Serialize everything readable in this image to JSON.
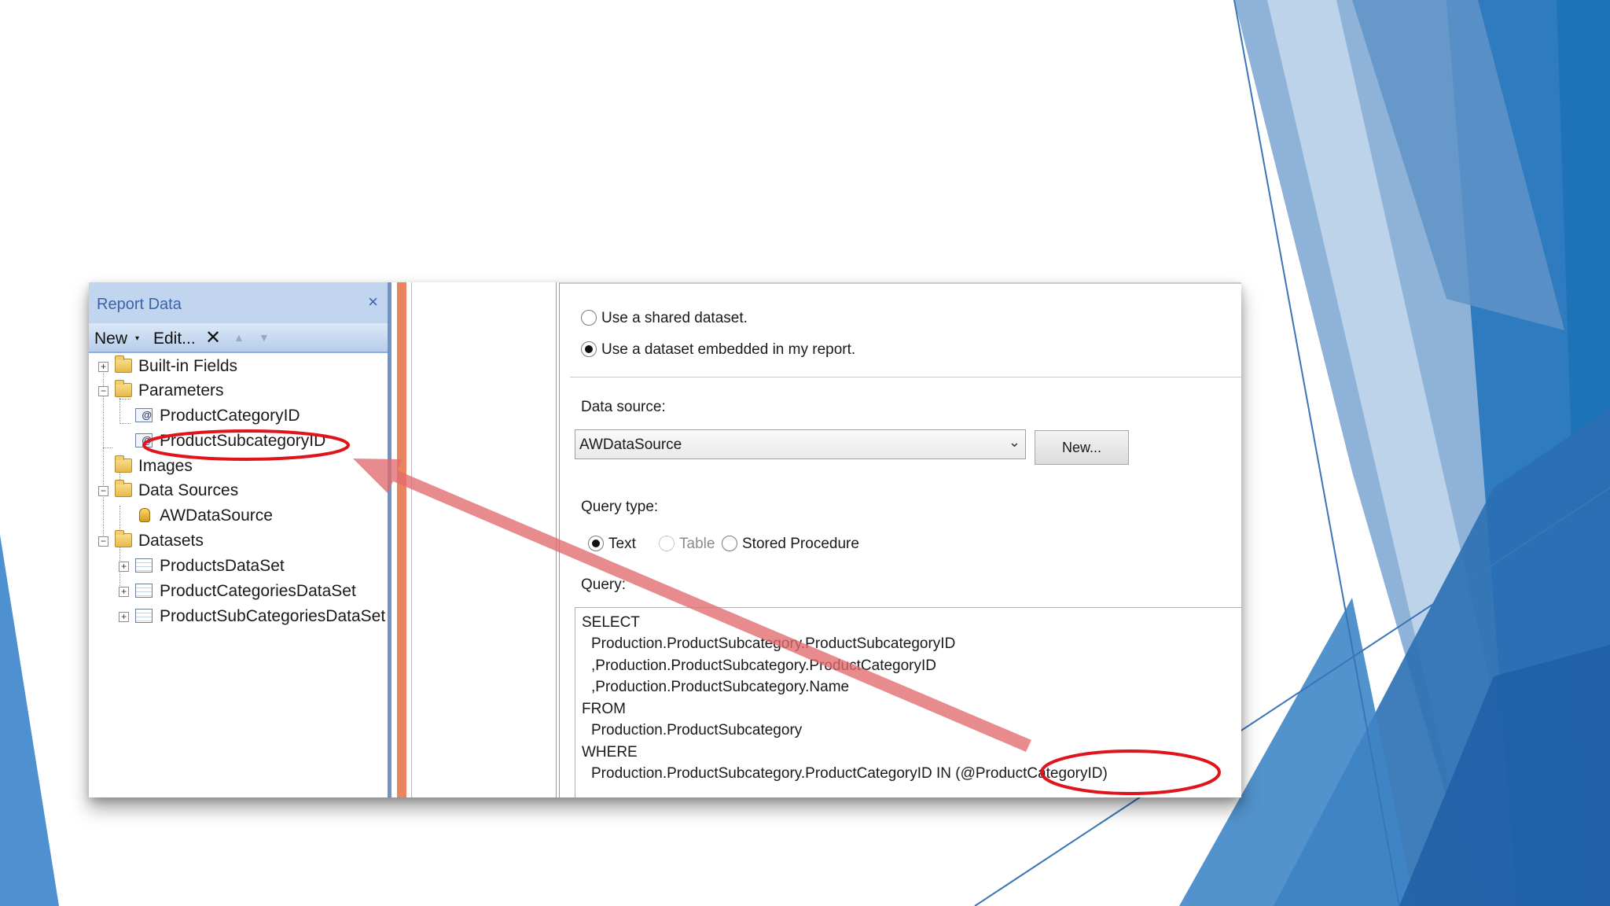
{
  "report_data": {
    "title": "Report Data",
    "close_icon": "×",
    "toolbar": {
      "new_label": "New",
      "new_caret": "▾",
      "edit_label": "Edit...",
      "delete_icon": "✕",
      "up_icon": "▲",
      "down_icon": "▼"
    },
    "tree": [
      {
        "label": "Built-in Fields",
        "expander": "+",
        "icon": "folder-icon"
      },
      {
        "label": "Parameters",
        "expander": "−",
        "icon": "folder-icon"
      },
      {
        "label": "ProductCategoryID",
        "icon": "parameter-icon"
      },
      {
        "label": "ProductSubcategoryID",
        "icon": "parameter-icon"
      },
      {
        "label": "Images",
        "icon": "folder-icon"
      },
      {
        "label": "Data Sources",
        "expander": "−",
        "icon": "folder-icon"
      },
      {
        "label": "AWDataSource",
        "icon": "datasource-icon"
      },
      {
        "label": "Datasets",
        "expander": "−",
        "icon": "folder-icon"
      },
      {
        "label": "ProductsDataSet",
        "expander": "+",
        "icon": "dataset-icon"
      },
      {
        "label": "ProductCategoriesDataSet",
        "expander": "+",
        "icon": "dataset-icon"
      },
      {
        "label": "ProductSubCategoriesDataSet",
        "expander": "+",
        "icon": "dataset-icon"
      }
    ],
    "param_icon_glyph": "@"
  },
  "dataset_properties": {
    "shared_dataset_label": "Use a shared dataset.",
    "embedded_dataset_label": "Use a dataset embedded in my report.",
    "selected_dataset_option": "embedded",
    "data_source_label": "Data source:",
    "data_source_value": "AWDataSource",
    "dropdown_caret": "⌄",
    "new_button_label": "New...",
    "query_type_label": "Query type:",
    "query_types": [
      "Text",
      "Table",
      "Stored Procedure"
    ],
    "selected_query_type": "Text",
    "query_label": "Query:",
    "query_lines": [
      "SELECT",
      "Production.ProductSubcategory.ProductSubcategoryID",
      ",Production.ProductSubcategory.ProductCategoryID",
      ",Production.ProductSubcategory.Name",
      "FROM",
      "Production.ProductSubcategory",
      "WHERE",
      "Production.ProductSubcategory.ProductCategoryID IN (@ProductCategoryID)"
    ]
  },
  "colors": {
    "annotation_red": "#e0141b",
    "arrow_fill": "#e06a6e",
    "pane_header": "#c2d5ef",
    "splitter_orange": "#e9845f",
    "accent_blue": "#2e6db4"
  }
}
